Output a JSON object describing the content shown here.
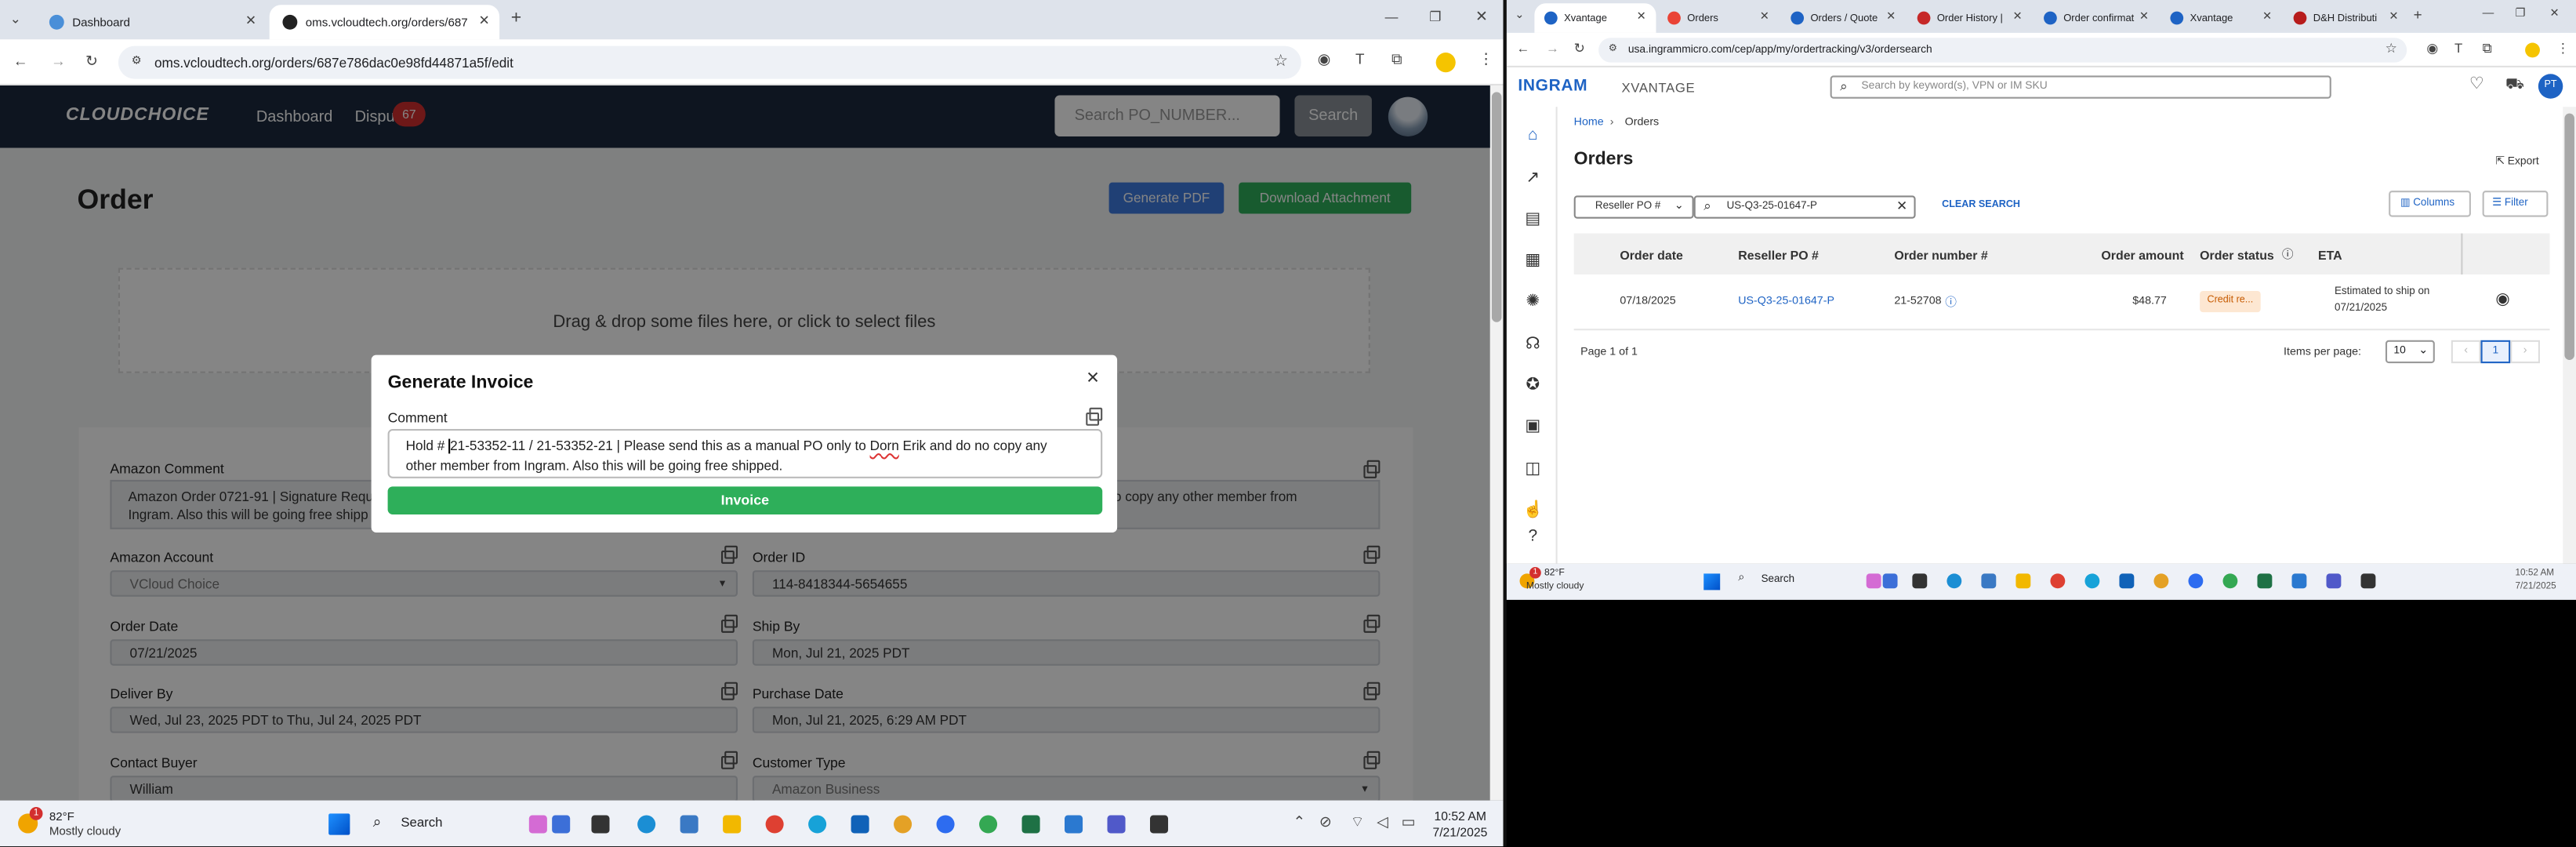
{
  "left_browser": {
    "tabs": [
      {
        "label": "Dashboard",
        "active": false
      },
      {
        "label": "oms.vcloudtech.org/orders/687",
        "active": true
      }
    ],
    "new_tab": "+",
    "url": "oms.vcloudtech.org/orders/687e786dac0e98fd44871a5f/edit",
    "window_controls": {
      "minimize": "—",
      "restore": "❐",
      "close": "✕"
    }
  },
  "app": {
    "logo": "CLOUDCHOICE",
    "nav": {
      "dashboard": "Dashboard",
      "disputes": "Dispu",
      "disputes_badge": "67"
    },
    "search": {
      "placeholder": "Search PO_NUMBER...",
      "button": "Search"
    },
    "page_title": "Order",
    "buttons": {
      "generate_pdf": "Generate PDF",
      "download_attachment": "Download Attachment"
    },
    "dropzone": "Drag & drop some files here, or click to select files",
    "amazon_comment_label": "Amazon Comment",
    "amazon_comment_left": "Amazon Order 0721-91 | Signature Requ",
    "amazon_comment_left2": "Ingram. Also this will be going free shipp",
    "amazon_comment_right": "o copy any other member from",
    "fields": {
      "amazon_account_label": "Amazon Account",
      "amazon_account_value": "VCloud Choice",
      "order_id_label": "Order ID",
      "order_id_value": "114-8418344-5654655",
      "order_date_label": "Order Date",
      "order_date_value": "07/21/2025",
      "ship_by_label": "Ship By",
      "ship_by_value": "Mon, Jul 21, 2025 PDT",
      "deliver_by_label": "Deliver By",
      "deliver_by_value": "Wed, Jul 23, 2025 PDT to Thu, Jul 24, 2025 PDT",
      "purchase_date_label": "Purchase Date",
      "purchase_date_value": "Mon, Jul 21, 2025, 6:29 AM PDT",
      "contact_buyer_label": "Contact Buyer",
      "contact_buyer_value": "William",
      "customer_type_label": "Customer Type",
      "customer_type_value": "Amazon Business"
    }
  },
  "modal": {
    "title": "Generate Invoice",
    "close": "✕",
    "comment_label": "Comment",
    "comment_line1_prefix": "Hold # ",
    "comment_line1_rest": "21-53352-11 / 21-53352-21 | Please send this as a manual PO only to ",
    "comment_name": "Dorn",
    "comment_line1_tail": " Erik and do no copy any",
    "comment_line2": "other member from Ingram. Also this will be going free shipped.",
    "invoice_button": "Invoice"
  },
  "left_taskbar": {
    "weather_temp": "82°F",
    "weather_desc": "Mostly cloudy",
    "weather_badge": "1",
    "search": "Search",
    "time": "10:52 AM",
    "date": "7/21/2025"
  },
  "right_browser": {
    "tabs": [
      {
        "label": "Xvantage",
        "active": true
      },
      {
        "label": "Orders",
        "active": false
      },
      {
        "label": "Orders / Quote",
        "active": false
      },
      {
        "label": "Order History |",
        "active": false
      },
      {
        "label": "Order confirmat",
        "active": false
      },
      {
        "label": "Xvantage",
        "active": false
      },
      {
        "label": "D&H Distributi",
        "active": false
      }
    ],
    "url": "usa.ingrammicro.com/cep/app/my/ordertracking/v3/ordersearch"
  },
  "ingram": {
    "logo_a": "INGRAM",
    "logo_b": "XVANTAGE",
    "search_placeholder": "Search by keyword(s), VPN or IM SKU",
    "avatar": "PT",
    "breadcrumb_home": "Home",
    "breadcrumb_sep": "›",
    "breadcrumb_current": "Orders",
    "title": "Orders",
    "export": "Export",
    "filter_select": "Reseller PO #",
    "filter_value": "US-Q3-25-01647-P",
    "clear_search": "CLEAR SEARCH",
    "columns_btn": "Columns",
    "filter_btn": "Filter",
    "table": {
      "headers": [
        "Order date",
        "Reseller PO #",
        "Order number #",
        "Order amount",
        "Order status",
        "ETA"
      ],
      "row": {
        "order_date": "07/18/2025",
        "reseller_po": "US-Q3-25-01647-P",
        "order_number": "21-52708",
        "order_amount": "$48.77",
        "status": "Credit re...",
        "eta_line1": "Estimated to ship on",
        "eta_line2": "07/21/2025"
      }
    },
    "pagination": {
      "page_info": "Page 1 of 1",
      "items_per_page_label": "Items per page:",
      "items_per_page": "10",
      "current_page": "1"
    }
  },
  "right_taskbar": {
    "weather_temp": "82°F",
    "weather_desc": "Mostly cloudy",
    "weather_badge": "1",
    "search": "Search",
    "time": "10:52 AM",
    "date": "7/21/2025"
  }
}
